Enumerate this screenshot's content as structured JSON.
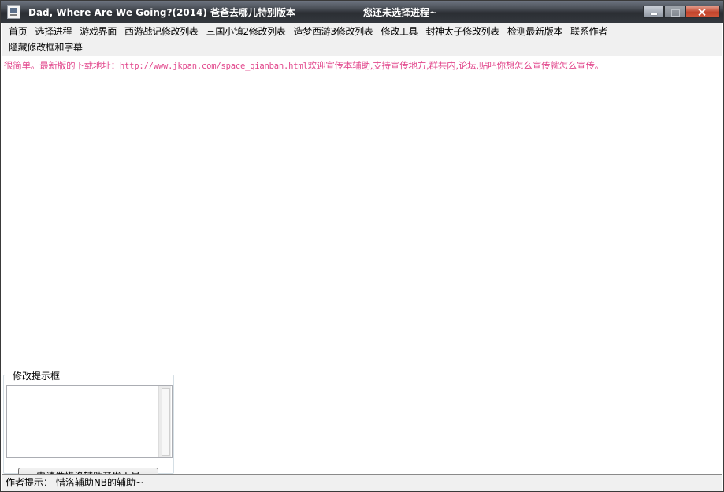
{
  "window": {
    "title": "Dad, Where Are We Going?(2014)  爸爸去哪儿特别版本",
    "status_title": "您还未选择进程~"
  },
  "menu": {
    "row1": [
      "首页",
      "选择进程",
      "游戏界面",
      "西游战记修改列表",
      "三国小镇2修改列表",
      "造梦西游3修改列表",
      "修改工具",
      "封神太子修改列表",
      "检测最新版本",
      "联系作者"
    ],
    "row2": [
      "隐藏修改框和字幕"
    ]
  },
  "marquee": {
    "prefix": "很简单。最新版的下载地址：",
    "url": "http://www.jkpan.com/space_qianban.html",
    "suffix": "欢迎宣传本辅助,支持宣传地方,群共内,论坛,贴吧你想怎么宣传就怎么宣传。"
  },
  "groupbox": {
    "legend": "修改提示框",
    "textarea_value": "",
    "button_label": "申请做惜洛辅助开发人员"
  },
  "statusbar": {
    "text": "作者提示：  惜洛辅助NB的辅助~"
  },
  "colors": {
    "marquee_text": "#e2478c",
    "titlebar": "#2b2e33",
    "close_button": "#c2432b"
  },
  "icons": {
    "app": "app-icon",
    "minimize": "minimize-icon",
    "maximize": "maximize-icon",
    "close": "close-icon"
  }
}
